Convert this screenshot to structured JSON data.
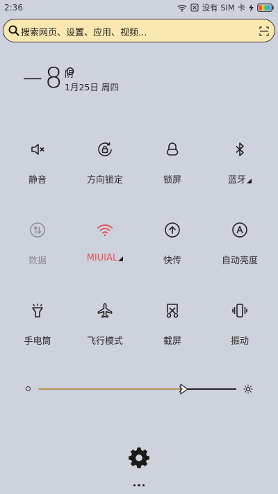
{
  "status_bar": {
    "time": "2:36",
    "sim_text": "没有 SIM 卡",
    "icons": [
      "wifi-icon",
      "no-sim-icon",
      "charging-icon",
      "battery-icon"
    ]
  },
  "search": {
    "placeholder": "搜索网页、设置、应用、视频...",
    "icons": [
      "search-icon",
      "scan-icon"
    ]
  },
  "weather": {
    "temperature": "−8°",
    "condition": "阴",
    "date": "1月25日 周四"
  },
  "tiles": [
    {
      "label": "静音",
      "icon": "mute-icon"
    },
    {
      "label": "方向锁定",
      "icon": "rotation-lock-icon"
    },
    {
      "label": "锁屏",
      "icon": "lock-icon"
    },
    {
      "label": "蓝牙",
      "icon": "bluetooth-icon"
    },
    {
      "label": "数据",
      "icon": "mobile-data-icon"
    },
    {
      "label": "MIUIAL",
      "icon": "wifi-icon"
    },
    {
      "label": "快传",
      "icon": "quick-transfer-icon"
    },
    {
      "label": "自动亮度",
      "icon": "auto-brightness-icon"
    },
    {
      "label": "手电筒",
      "icon": "flashlight-icon"
    },
    {
      "label": "飞行模式",
      "icon": "airplane-icon"
    },
    {
      "label": "截屏",
      "icon": "screenshot-icon"
    },
    {
      "label": "振动",
      "icon": "vibrate-icon"
    }
  ],
  "brightness": {
    "level": 0.75
  },
  "colors": {
    "background": "#ced2dc",
    "search_bg": "#fbe8b0",
    "wifi_active": "#e05050",
    "slider_fill": "#b49356"
  }
}
